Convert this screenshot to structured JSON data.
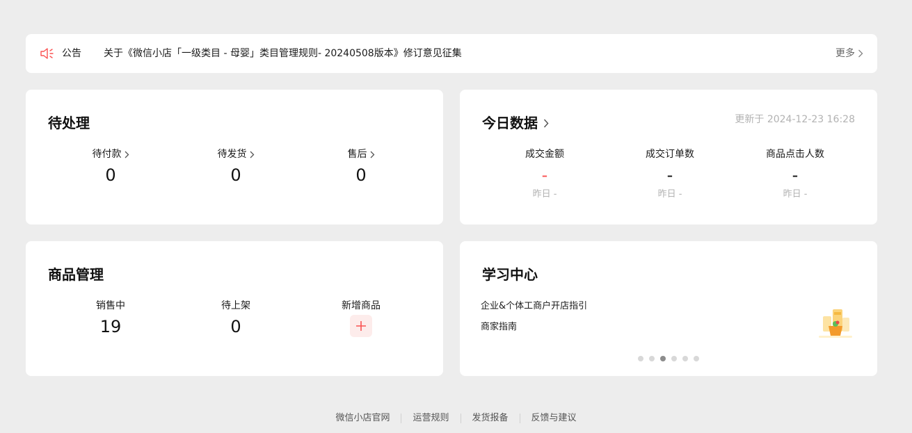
{
  "notice": {
    "tag": "公告",
    "message": "关于《微信小店「一级类目 - 母婴」类目管理规则- 20240508版本》修订意见征集",
    "more": "更多"
  },
  "pending": {
    "title": "待处理",
    "items": [
      {
        "label": "待付款",
        "value": "0"
      },
      {
        "label": "待发货",
        "value": "0"
      },
      {
        "label": "售后",
        "value": "0"
      }
    ]
  },
  "today": {
    "title": "今日数据",
    "updated": "更新于 2024-12-23 16:28",
    "items": [
      {
        "label": "成交金额",
        "value": "-",
        "yesterday": "昨日 -"
      },
      {
        "label": "成交订单数",
        "value": "-",
        "yesterday": "昨日 -"
      },
      {
        "label": "商品点击人数",
        "value": "-",
        "yesterday": "昨日 -"
      }
    ]
  },
  "goods": {
    "title": "商品管理",
    "items": [
      {
        "label": "销售中",
        "value": "19"
      },
      {
        "label": "待上架",
        "value": "0"
      },
      {
        "label": "新增商品"
      }
    ]
  },
  "learn": {
    "title": "学习中心",
    "items": [
      "企业&个体工商户开店指引",
      "商家指南"
    ],
    "carousel_active_index": 2
  },
  "footer": {
    "links": [
      "微信小店官网",
      "运营规则",
      "发货报备",
      "反馈与建议"
    ]
  },
  "colors": {
    "accent": "#fa5151",
    "background": "#ededed",
    "card": "#ffffff"
  }
}
